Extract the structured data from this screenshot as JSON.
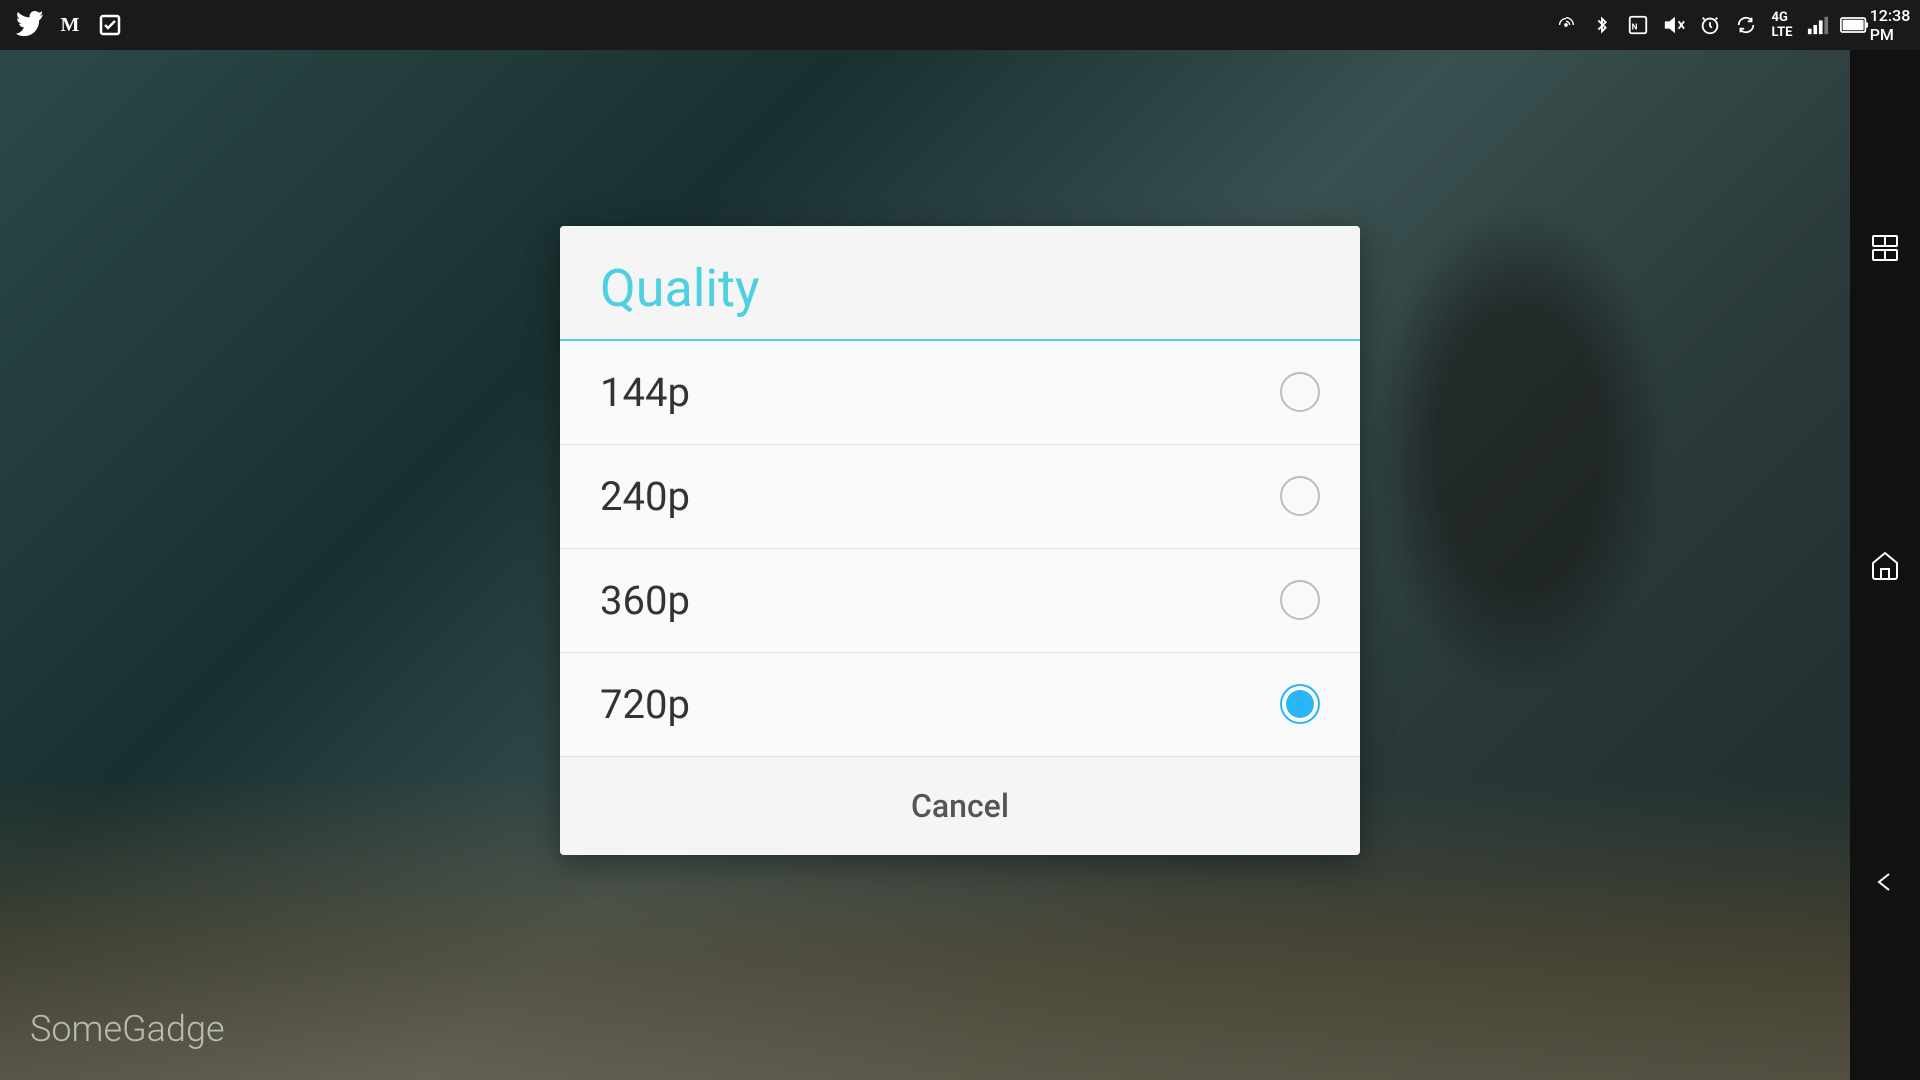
{
  "statusBar": {
    "time": "12:38 PM",
    "icons": [
      "twitter",
      "gmail",
      "tasks"
    ]
  },
  "dialog": {
    "title": "Quality",
    "options": [
      {
        "label": "144p",
        "selected": false
      },
      {
        "label": "240p",
        "selected": false
      },
      {
        "label": "360p",
        "selected": false
      },
      {
        "label": "720p",
        "selected": true
      }
    ],
    "cancelLabel": "Cancel"
  },
  "watermark": "SomeGadge",
  "navIcons": [
    "multiwindow",
    "home",
    "back"
  ]
}
